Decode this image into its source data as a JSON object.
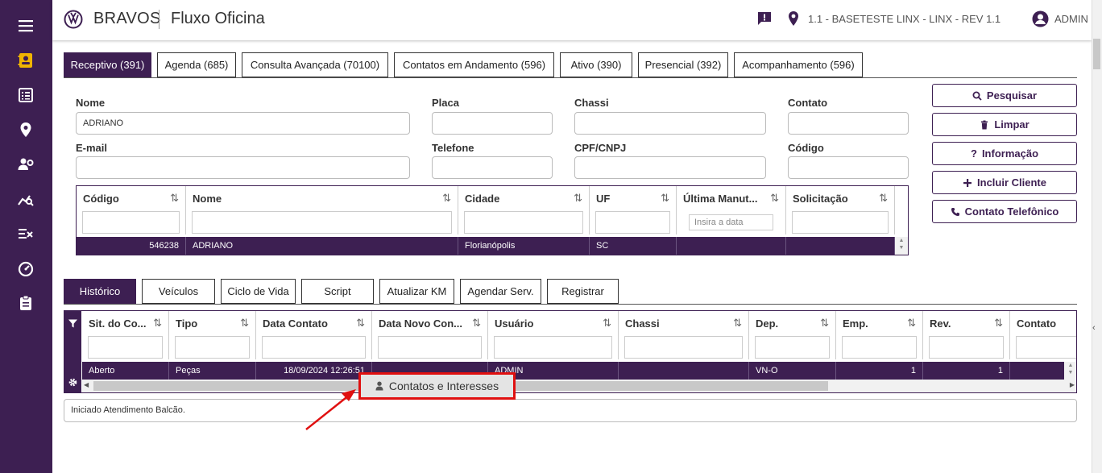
{
  "header": {
    "brand": "BRAVOS",
    "app_title": "Fluxo Oficina",
    "location": "1.1 - BASETESTE LINX - LINX - REV 1.1",
    "user": "ADMIN"
  },
  "sidebar": {
    "icons": [
      "menu-icon",
      "contact-card-icon",
      "list-icon",
      "location-pin-icon",
      "user-gear-icon",
      "analytics-icon",
      "checklist-icon",
      "speedometer-icon",
      "clipboard-icon"
    ],
    "active_color": "#f0b400"
  },
  "main_tabs": [
    {
      "label": "Receptivo (391)",
      "active": true
    },
    {
      "label": "Agenda (685)"
    },
    {
      "label": "Consulta Avançada (70100)"
    },
    {
      "label": "Contatos em Andamento (596)"
    },
    {
      "label": "Ativo (390)"
    },
    {
      "label": "Presencial (392)"
    },
    {
      "label": "Acompanhamento (596)"
    }
  ],
  "form": {
    "nome_label": "Nome",
    "nome_value": "ADRIANO",
    "placa_label": "Placa",
    "chassi_label": "Chassi",
    "contato_label": "Contato",
    "email_label": "E-mail",
    "telefone_label": "Telefone",
    "cpf_label": "CPF/CNPJ",
    "codigo_label": "Código"
  },
  "actions": {
    "pesquisar": "Pesquisar",
    "limpar": "Limpar",
    "informacao": "Informação",
    "incluir": "Incluir Cliente",
    "contato_tel": "Contato Telefônico"
  },
  "client_grid": {
    "columns": [
      "Código",
      "Nome",
      "Cidade",
      "UF",
      "Última Manut...",
      "Solicitação"
    ],
    "date_placeholder": "Insira a data",
    "rows": [
      {
        "codigo": "546238",
        "nome": "ADRIANO",
        "cidade": "Florianópolis",
        "uf": "SC",
        "ultima": "",
        "solicitacao": ""
      }
    ]
  },
  "history_tabs": [
    {
      "label": "Histórico",
      "active": true
    },
    {
      "label": "Veículos"
    },
    {
      "label": "Ciclo de Vida"
    },
    {
      "label": "Script"
    },
    {
      "label": "Atualizar KM"
    },
    {
      "label": "Agendar Serv."
    },
    {
      "label": "Registrar"
    }
  ],
  "history_grid": {
    "columns": [
      "Sit. do Co...",
      "Tipo",
      "Data Contato",
      "Data Novo Con...",
      "Usuário",
      "Chassi",
      "Dep.",
      "Emp.",
      "Rev.",
      "Contato"
    ],
    "rows": [
      {
        "sit": "Aberto",
        "tipo": "Peças",
        "data": "18/09/2024 12:26:51",
        "novo": "",
        "usuario": "ADMIN",
        "chassi": "",
        "dep": "VN-O",
        "emp": "1",
        "rev": "1",
        "contato": ""
      }
    ]
  },
  "note": "Iniciado Atendimento Balcão.",
  "tooltip": {
    "label": "Contatos e Interesses",
    "highlight_color": "#e01010"
  }
}
